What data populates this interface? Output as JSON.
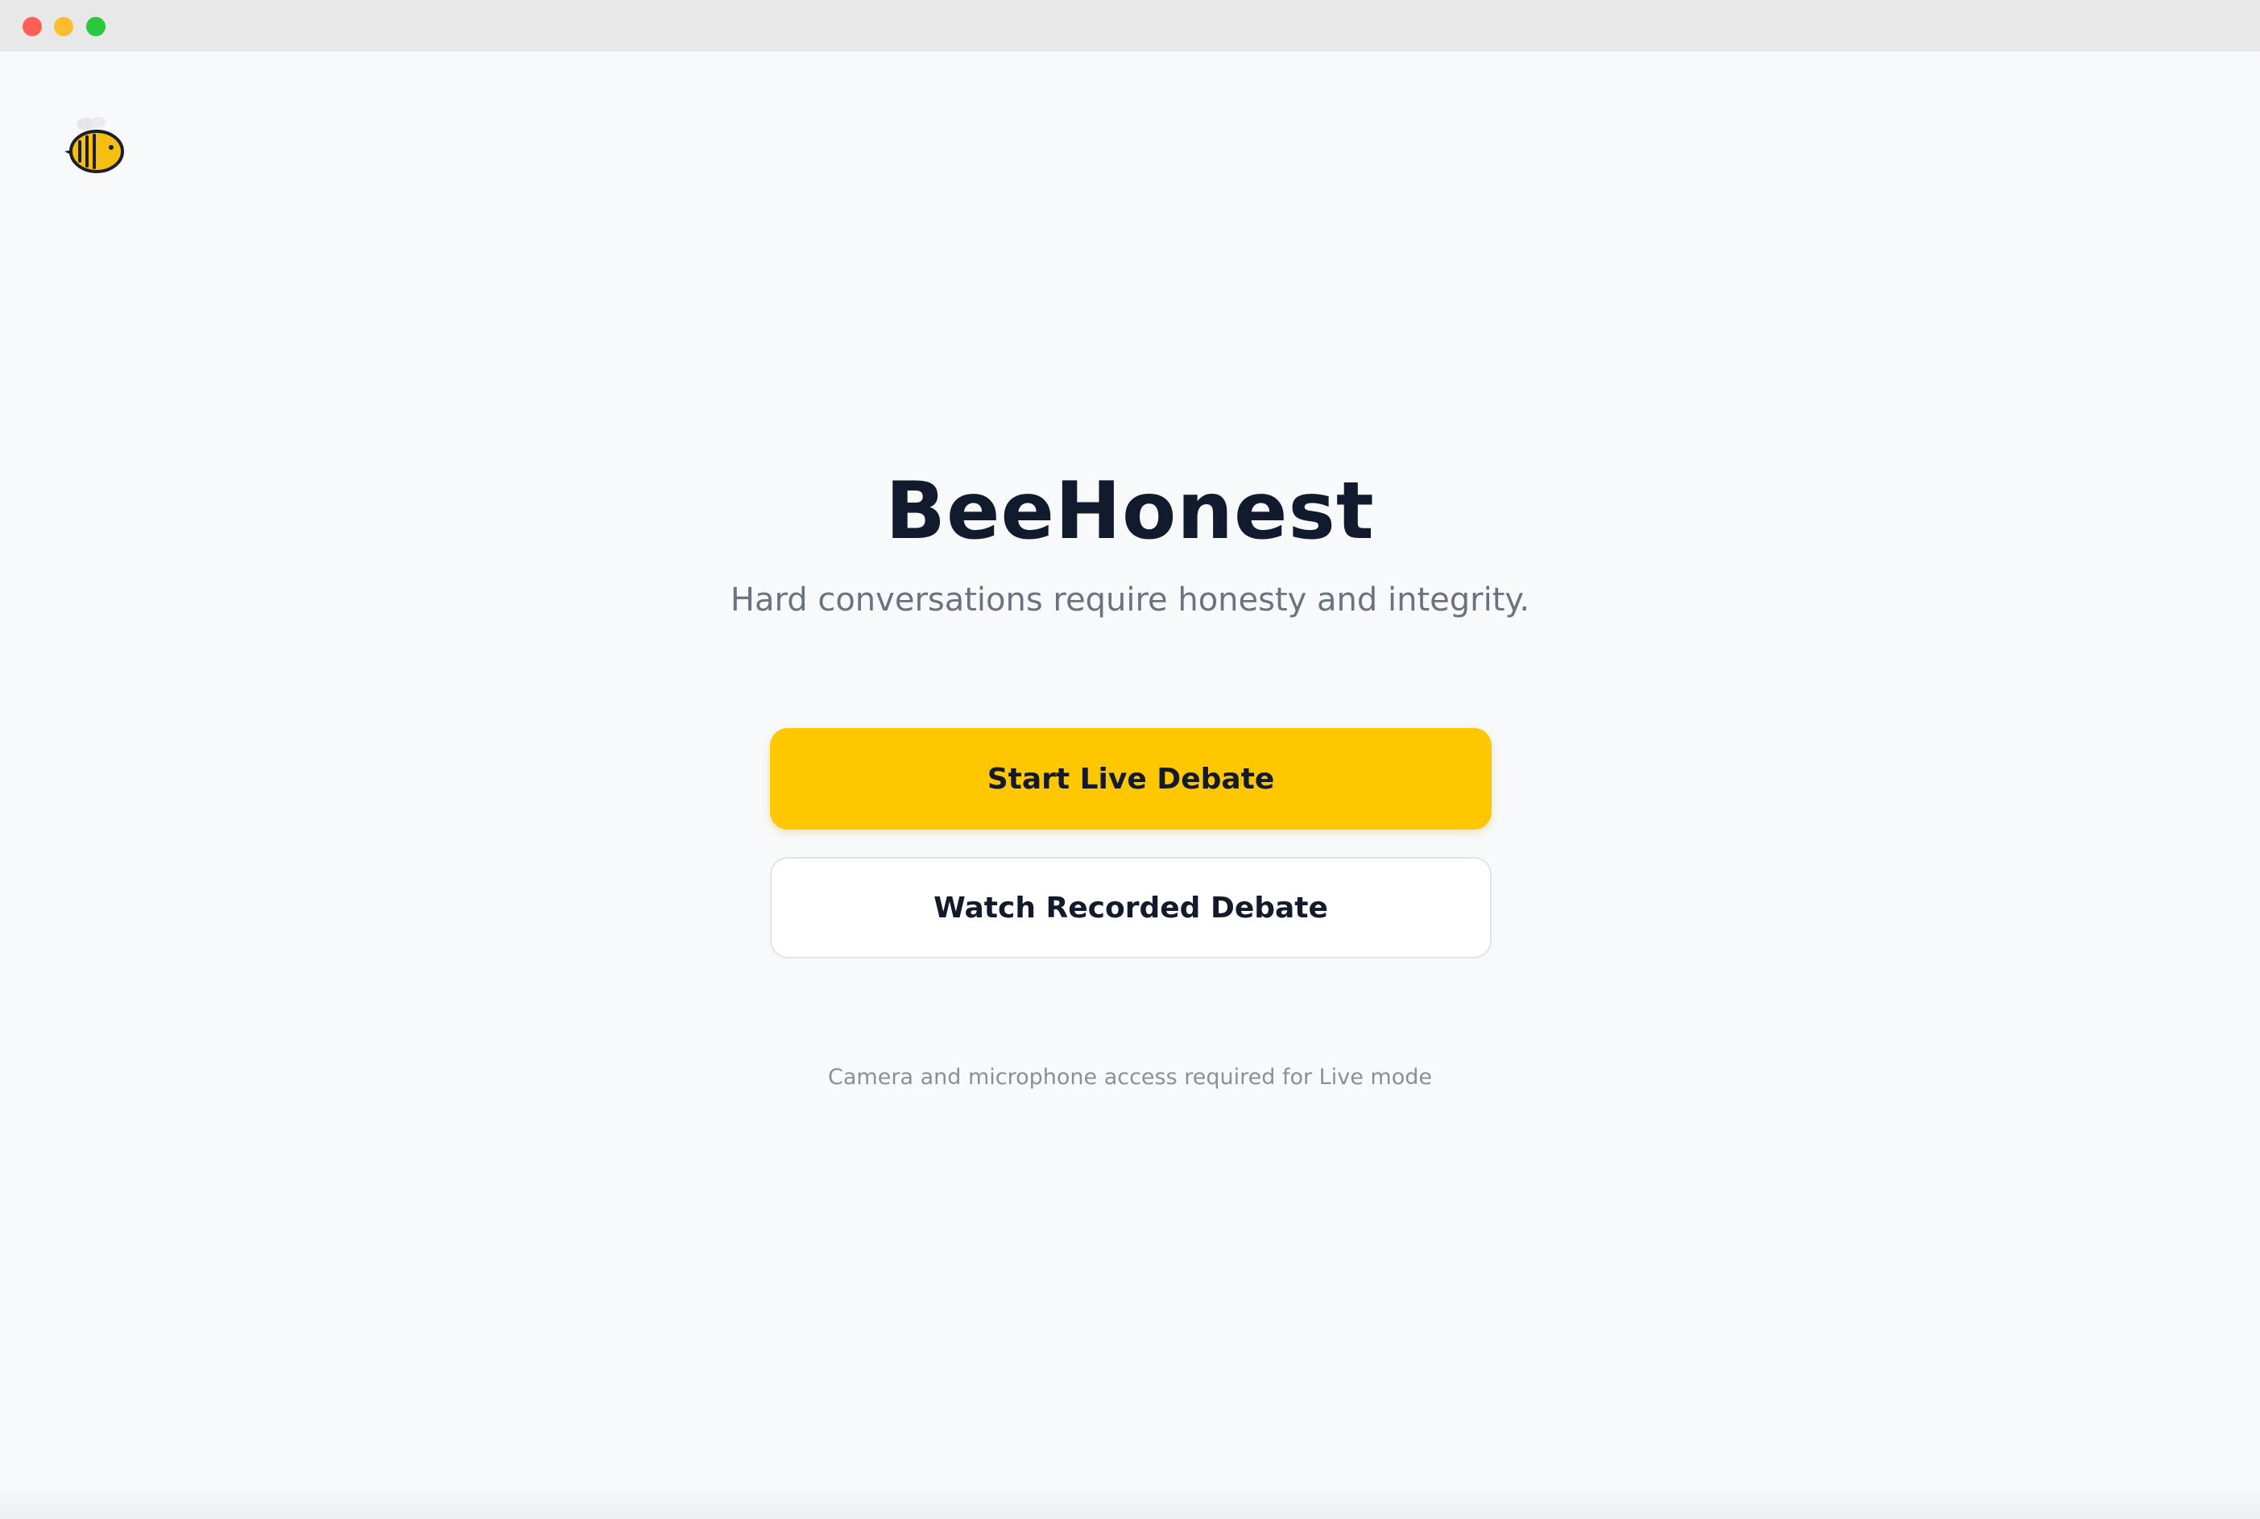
{
  "window": {
    "controls": [
      "close",
      "minimize",
      "zoom"
    ],
    "colors": {
      "close": "#ff5f57",
      "minimize": "#febc2e",
      "zoom": "#28c840"
    }
  },
  "logo": {
    "icon": "bee-icon",
    "colors": {
      "body": "#f5bf12",
      "stripes": "#1b1f2a",
      "wing": "#e6e6e8"
    }
  },
  "hero": {
    "title": "BeeHonest",
    "subtitle": "Hard conversations require honesty and integrity."
  },
  "actions": {
    "primary_label": "Start Live Debate",
    "secondary_label": "Watch Recorded Debate",
    "accent_color": "#ffc700"
  },
  "footnote": "Camera and microphone access required for Live mode"
}
